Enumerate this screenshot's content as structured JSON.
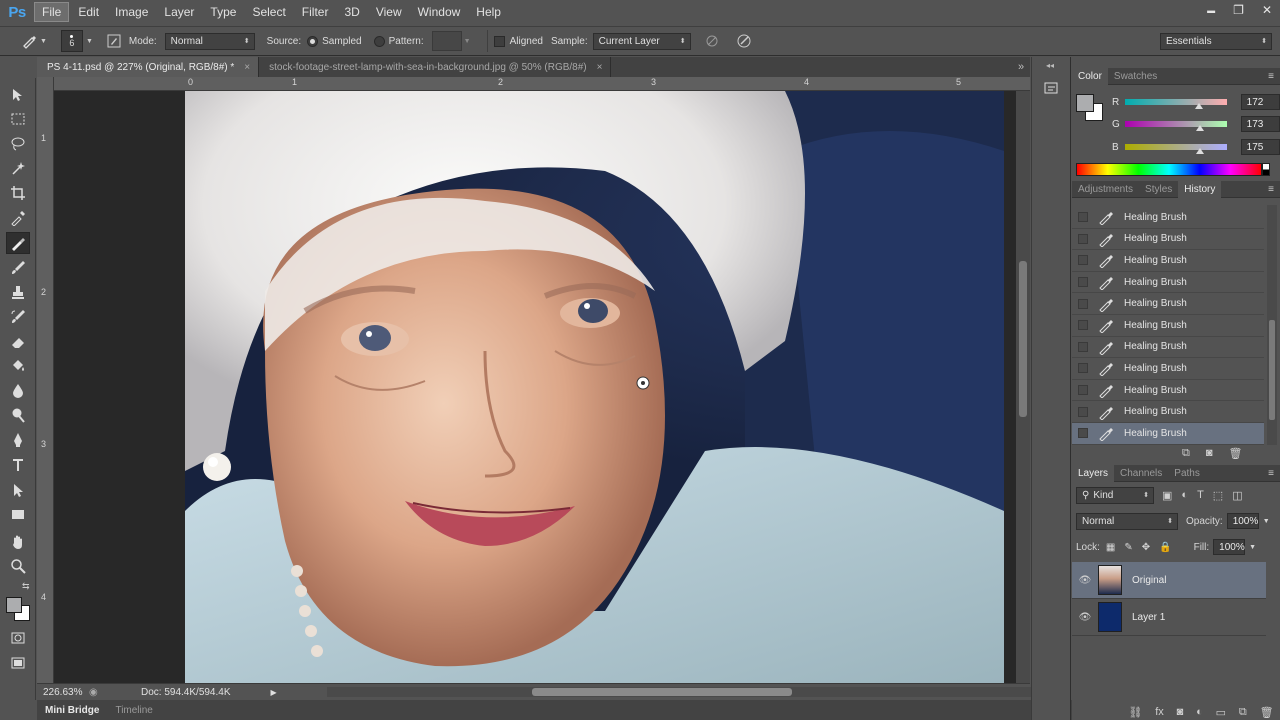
{
  "app": {
    "logo": "Ps"
  },
  "menu": [
    "File",
    "Edit",
    "Image",
    "Layer",
    "Type",
    "Select",
    "Filter",
    "3D",
    "View",
    "Window",
    "Help"
  ],
  "window_controls": {
    "minimize": "▬",
    "restore": "❐",
    "close": "✕"
  },
  "options": {
    "brush_size": "6",
    "mode_label": "Mode:",
    "mode_value": "Normal",
    "source_label": "Source:",
    "sampled_label": "Sampled",
    "pattern_label": "Pattern:",
    "aligned_label": "Aligned",
    "sample_label": "Sample:",
    "sample_value": "Current Layer",
    "workspace": "Essentials"
  },
  "doc_tabs": [
    {
      "label": "PS 4-11.psd @ 227% (Original, RGB/8#) *",
      "close": "×"
    },
    {
      "label": "stock-footage-street-lamp-with-sea-in-background.jpg @ 50% (RGB/8#)",
      "close": "×"
    }
  ],
  "ruler": {
    "h_marks": [
      "0",
      "1",
      "2",
      "3",
      "4",
      "5"
    ],
    "v_marks": [
      "1",
      "2",
      "3",
      "4"
    ]
  },
  "status": {
    "zoom": "226.63%",
    "doc": "Doc: 594.4K/594.4K"
  },
  "bottom_tabs": [
    "Mini Bridge",
    "Timeline"
  ],
  "color_panel": {
    "tabs": [
      "Color",
      "Swatches"
    ],
    "r_label": "R",
    "g_label": "G",
    "b_label": "B",
    "r": "172",
    "g": "173",
    "b": "175",
    "r_level": 0.674,
    "g_level": 0.678,
    "b_level": 0.686,
    "foreground_color": "#acadaf"
  },
  "history_panel": {
    "tabs": [
      "Adjustments",
      "Styles",
      "History"
    ],
    "items": [
      "Healing Brush",
      "Healing Brush",
      "Healing Brush",
      "Healing Brush",
      "Healing Brush",
      "Healing Brush",
      "Healing Brush",
      "Healing Brush",
      "Healing Brush",
      "Healing Brush",
      "Healing Brush"
    ]
  },
  "layers_panel": {
    "tabs": [
      "Layers",
      "Channels",
      "Paths"
    ],
    "kind_label": "Kind",
    "blend_mode": "Normal",
    "opacity_label": "Opacity:",
    "opacity": "100%",
    "lock_label": "Lock:",
    "fill_label": "Fill:",
    "fill": "100%",
    "layers": [
      {
        "name": "Original",
        "thumb": "photo",
        "selected": true
      },
      {
        "name": "Layer 1",
        "thumb": "#0d2a6b",
        "selected": false
      }
    ]
  }
}
